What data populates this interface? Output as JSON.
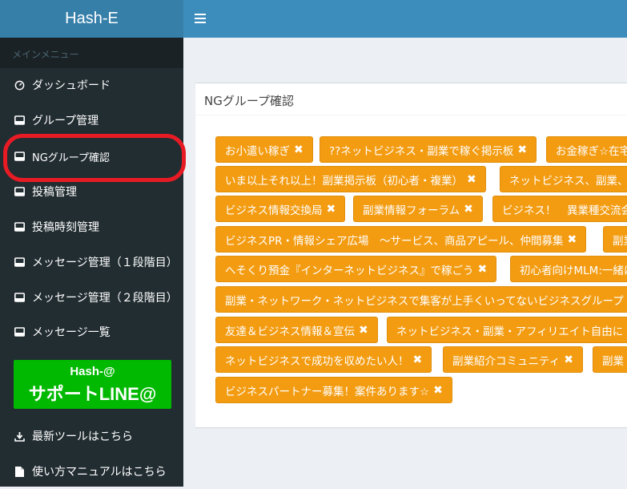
{
  "brand": {
    "title": "Hash-E"
  },
  "sidebar": {
    "header": "メインメニュー",
    "items": [
      {
        "label": "ダッシュボード",
        "icon": "dashboard-icon"
      },
      {
        "label": "グループ管理",
        "icon": "inbox-icon"
      },
      {
        "label": "NGグループ確認",
        "icon": "inbox-icon"
      },
      {
        "label": "投稿管理",
        "icon": "inbox-icon"
      },
      {
        "label": "投稿時刻管理",
        "icon": "inbox-icon"
      },
      {
        "label": "メッセージ管理（１段階目）",
        "icon": "inbox-icon"
      },
      {
        "label": "メッセージ管理（２段階目）",
        "icon": "inbox-icon"
      },
      {
        "label": "メッセージ一覧",
        "icon": "inbox-icon"
      },
      {
        "label": "最新ツールはこちら",
        "icon": "download-icon"
      },
      {
        "label": "使い方マニュアルはこちら",
        "icon": "file-icon"
      }
    ],
    "line_banner": {
      "line1": "Hash-@",
      "line2": "サポートLINE@"
    }
  },
  "box": {
    "title": "NGグループ確認",
    "tags": [
      "お小遣い稼ぎ",
      "??ネットビジネス・副業で稼ぐ掲示板",
      "お金稼ぎ☆在宅",
      "いま以上それ以上！副業掲示板（初心者・複業）",
      "ネットビジネス、副業、",
      "ビジネス情報交換局",
      "副業情報フォーラム",
      "ビジネス！　異業種交流会",
      "ビジネスPR・情報シェア広場　～サービス、商品アピール、仲間募集",
      "副業",
      "へそくり預金『インターネットビジネス』で稼ごう",
      "初心者向けMLM:一緒に",
      "副業・ネットワーク・ネットビジネスで集客が上手くいってないビジネスグループ",
      "友達＆ビジネス情報＆宣伝",
      "ネットビジネス・副業・アフィリエイト自由に",
      "ネットビジネスで成功を収めたい人！",
      "副業紹介コミュニティ",
      "副業",
      "ビジネスパートナー募集！案件あります☆"
    ]
  },
  "colors": {
    "tag_bg": "#f39c12",
    "sidebar_bg": "#222d32",
    "topbar_bg": "#3c8dbc",
    "highlight": "#e81b24",
    "line_green": "#00b900"
  }
}
